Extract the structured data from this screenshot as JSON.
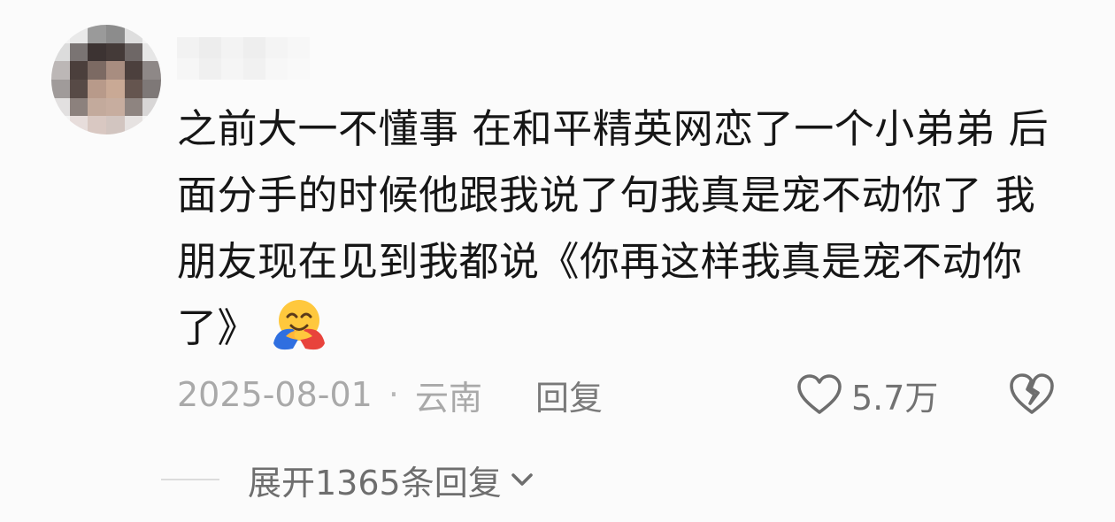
{
  "comment": {
    "text": "之前大一不懂事 在和平精英网恋了一个小弟弟 后面分手的时候他跟我说了句我真是宠不动你了 我朋友现在见到我都说《你再这样我真是宠不动你了》",
    "emoji_icon": "hugging-face-emoji"
  },
  "meta": {
    "date": "2025-08-01",
    "separator": "·",
    "location": "云南",
    "reply_label": "回复"
  },
  "actions": {
    "like_icon": "heart-outline-icon",
    "like_count": "5.7万",
    "dislike_icon": "broken-heart-icon"
  },
  "replies": {
    "expand_label": "展开1365条回复",
    "expand_icon": "chevron-down-icon"
  },
  "colors": {
    "background": "#fbfbfb",
    "text_primary": "#161616",
    "text_secondary": "#a9a9a9",
    "icon_gray": "#6e6e6e"
  }
}
